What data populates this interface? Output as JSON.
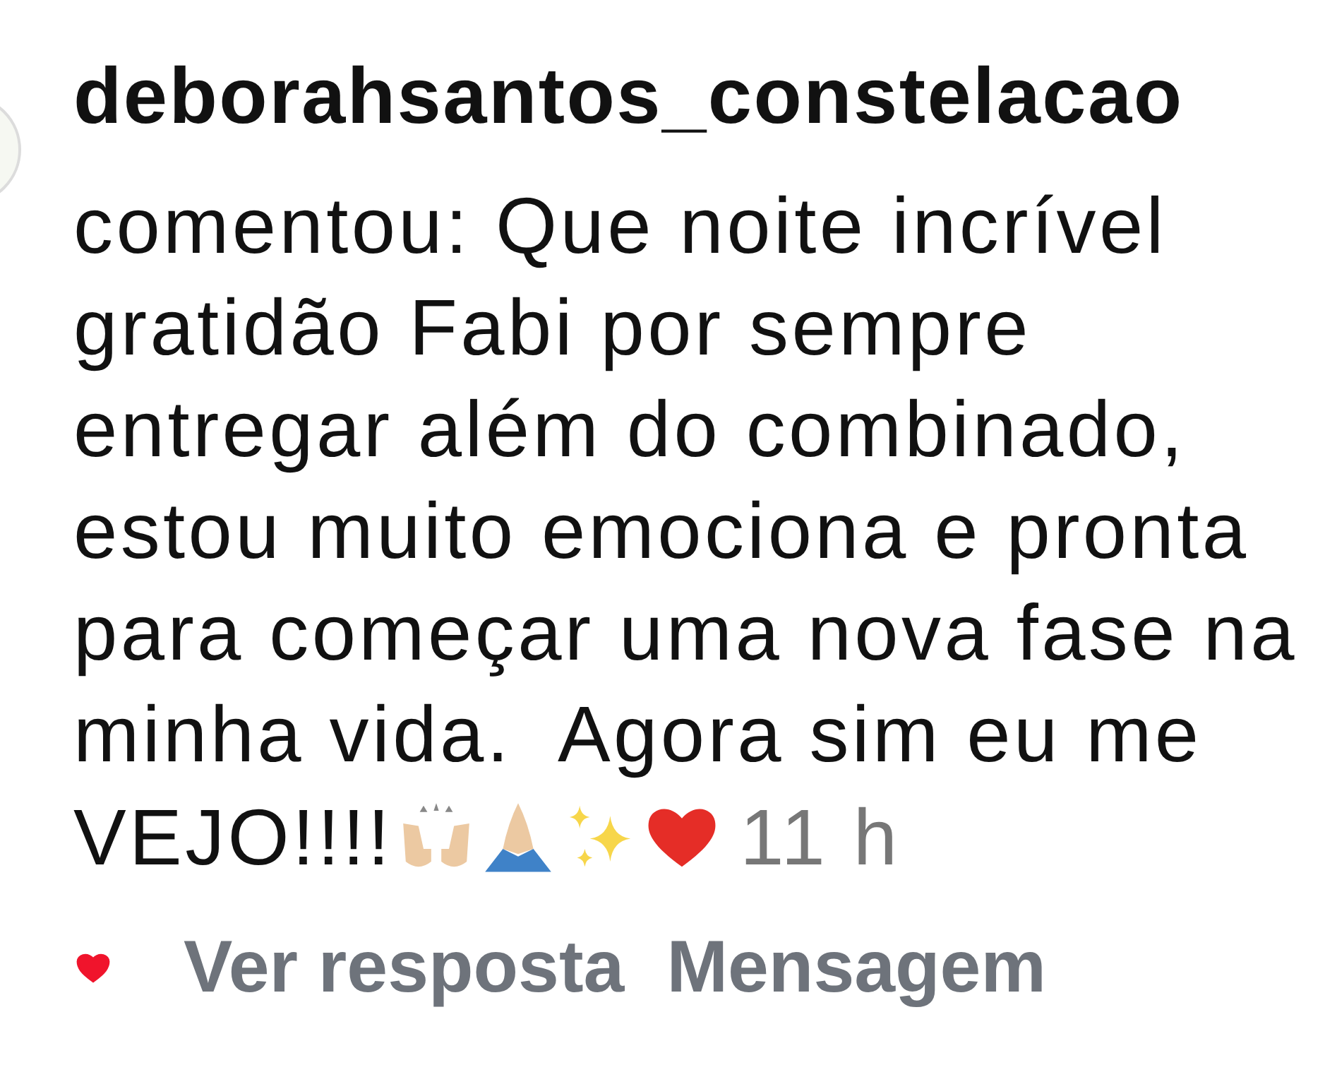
{
  "comment": {
    "username": "deborahsantos_constelacao",
    "text": "comentou: Que noite incrível gratidão Fabi por sempre entregar além do combinado, estou muito emociona e pronta para começar uma nova fase na minha vida.  Agora sim eu me",
    "last_words": "VEJO!!!!",
    "time": "11 h",
    "liked": true
  },
  "actions": [
    {
      "label": "Ver resposta"
    },
    {
      "label": "Mensagem"
    }
  ]
}
